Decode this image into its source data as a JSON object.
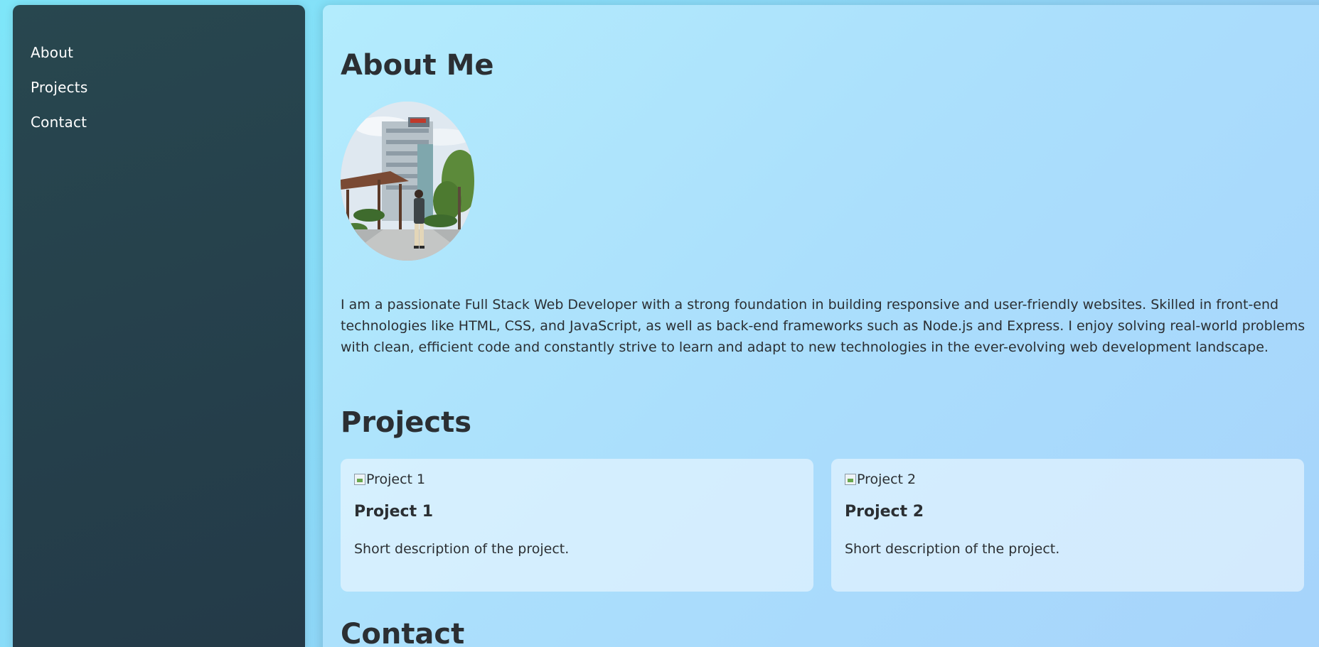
{
  "nav": {
    "items": [
      {
        "label": "About"
      },
      {
        "label": "Projects"
      },
      {
        "label": "Contact"
      }
    ]
  },
  "about": {
    "title": "About Me",
    "bio": "I am a passionate Full Stack Web Developer with a strong foundation in building responsive and user-friendly websites. Skilled in front-end technologies like HTML, CSS, and JavaScript, as well as back-end frameworks such as Node.js and Express. I enjoy solving real-world problems with clean, efficient code and constantly strive to learn and adapt to new technologies in the ever-evolving web development landscape."
  },
  "projects": {
    "title": "Projects",
    "items": [
      {
        "img_alt": "Project 1",
        "title": "Project 1",
        "description": "Short description of the project."
      },
      {
        "img_alt": "Project 2",
        "title": "Project 2",
        "description": "Short description of the project."
      }
    ]
  },
  "contact": {
    "title": "Contact"
  },
  "colors": {
    "sidebar": "#28474f",
    "text": "#2b2f33",
    "nav_text": "#ffffff"
  }
}
